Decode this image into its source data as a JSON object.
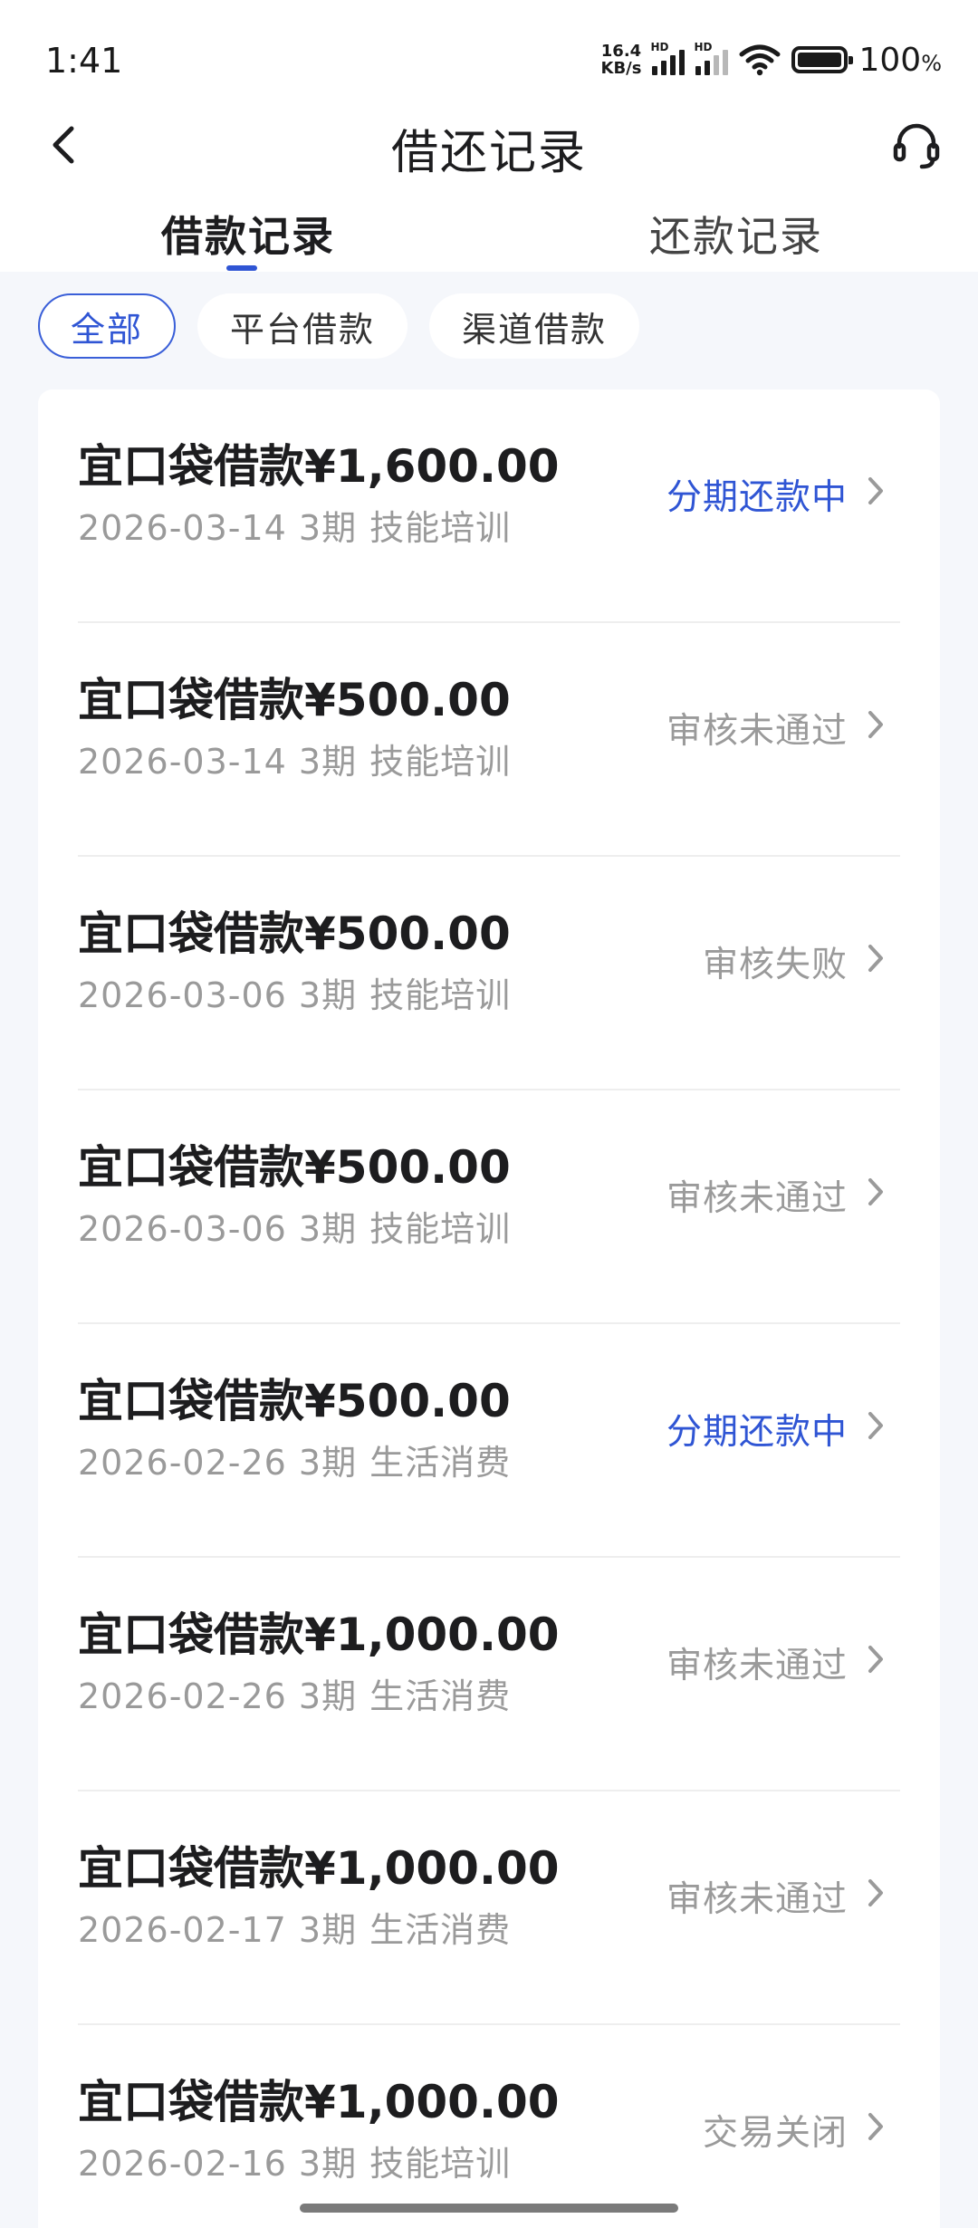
{
  "status_bar": {
    "time": "1:41",
    "net_speed_value": "16.4",
    "net_speed_unit": "KB/s",
    "signal_badge_1": "HD",
    "signal_badge_2": "HD",
    "battery_percent": "100",
    "battery_percent_sign": "%"
  },
  "header": {
    "title": "借还记录",
    "back_icon": "chevron-left-icon",
    "service_icon": "headset-icon"
  },
  "tabs": {
    "borrow_label": "借款记录",
    "repay_label": "还款记录",
    "active": "borrow"
  },
  "filters": {
    "all": "全部",
    "platform": "平台借款",
    "channel": "渠道借款",
    "active": "all"
  },
  "colors": {
    "accent": "#2f55d4",
    "muted_text": "#9a9a9a",
    "content_bg": "#f5f7fb"
  },
  "loans": [
    {
      "title": "宜口袋借款¥1,600.00",
      "date_term": "2026-03-14 3期",
      "category": "技能培训",
      "status": "分期还款中",
      "status_type": "active"
    },
    {
      "title": "宜口袋借款¥500.00",
      "date_term": "2026-03-14 3期",
      "category": "技能培训",
      "status": "审核未通过",
      "status_type": "muted"
    },
    {
      "title": "宜口袋借款¥500.00",
      "date_term": "2026-03-06 3期",
      "category": "技能培训",
      "status": "审核失败",
      "status_type": "muted"
    },
    {
      "title": "宜口袋借款¥500.00",
      "date_term": "2026-03-06 3期",
      "category": "技能培训",
      "status": "审核未通过",
      "status_type": "muted"
    },
    {
      "title": "宜口袋借款¥500.00",
      "date_term": "2026-02-26 3期",
      "category": "生活消费",
      "status": "分期还款中",
      "status_type": "active"
    },
    {
      "title": "宜口袋借款¥1,000.00",
      "date_term": "2026-02-26 3期",
      "category": "生活消费",
      "status": "审核未通过",
      "status_type": "muted"
    },
    {
      "title": "宜口袋借款¥1,000.00",
      "date_term": "2026-02-17 3期",
      "category": "生活消费",
      "status": "审核未通过",
      "status_type": "muted"
    },
    {
      "title": "宜口袋借款¥1,000.00",
      "date_term": "2026-02-16 3期",
      "category": "技能培训",
      "status": "交易关闭",
      "status_type": "muted"
    }
  ]
}
